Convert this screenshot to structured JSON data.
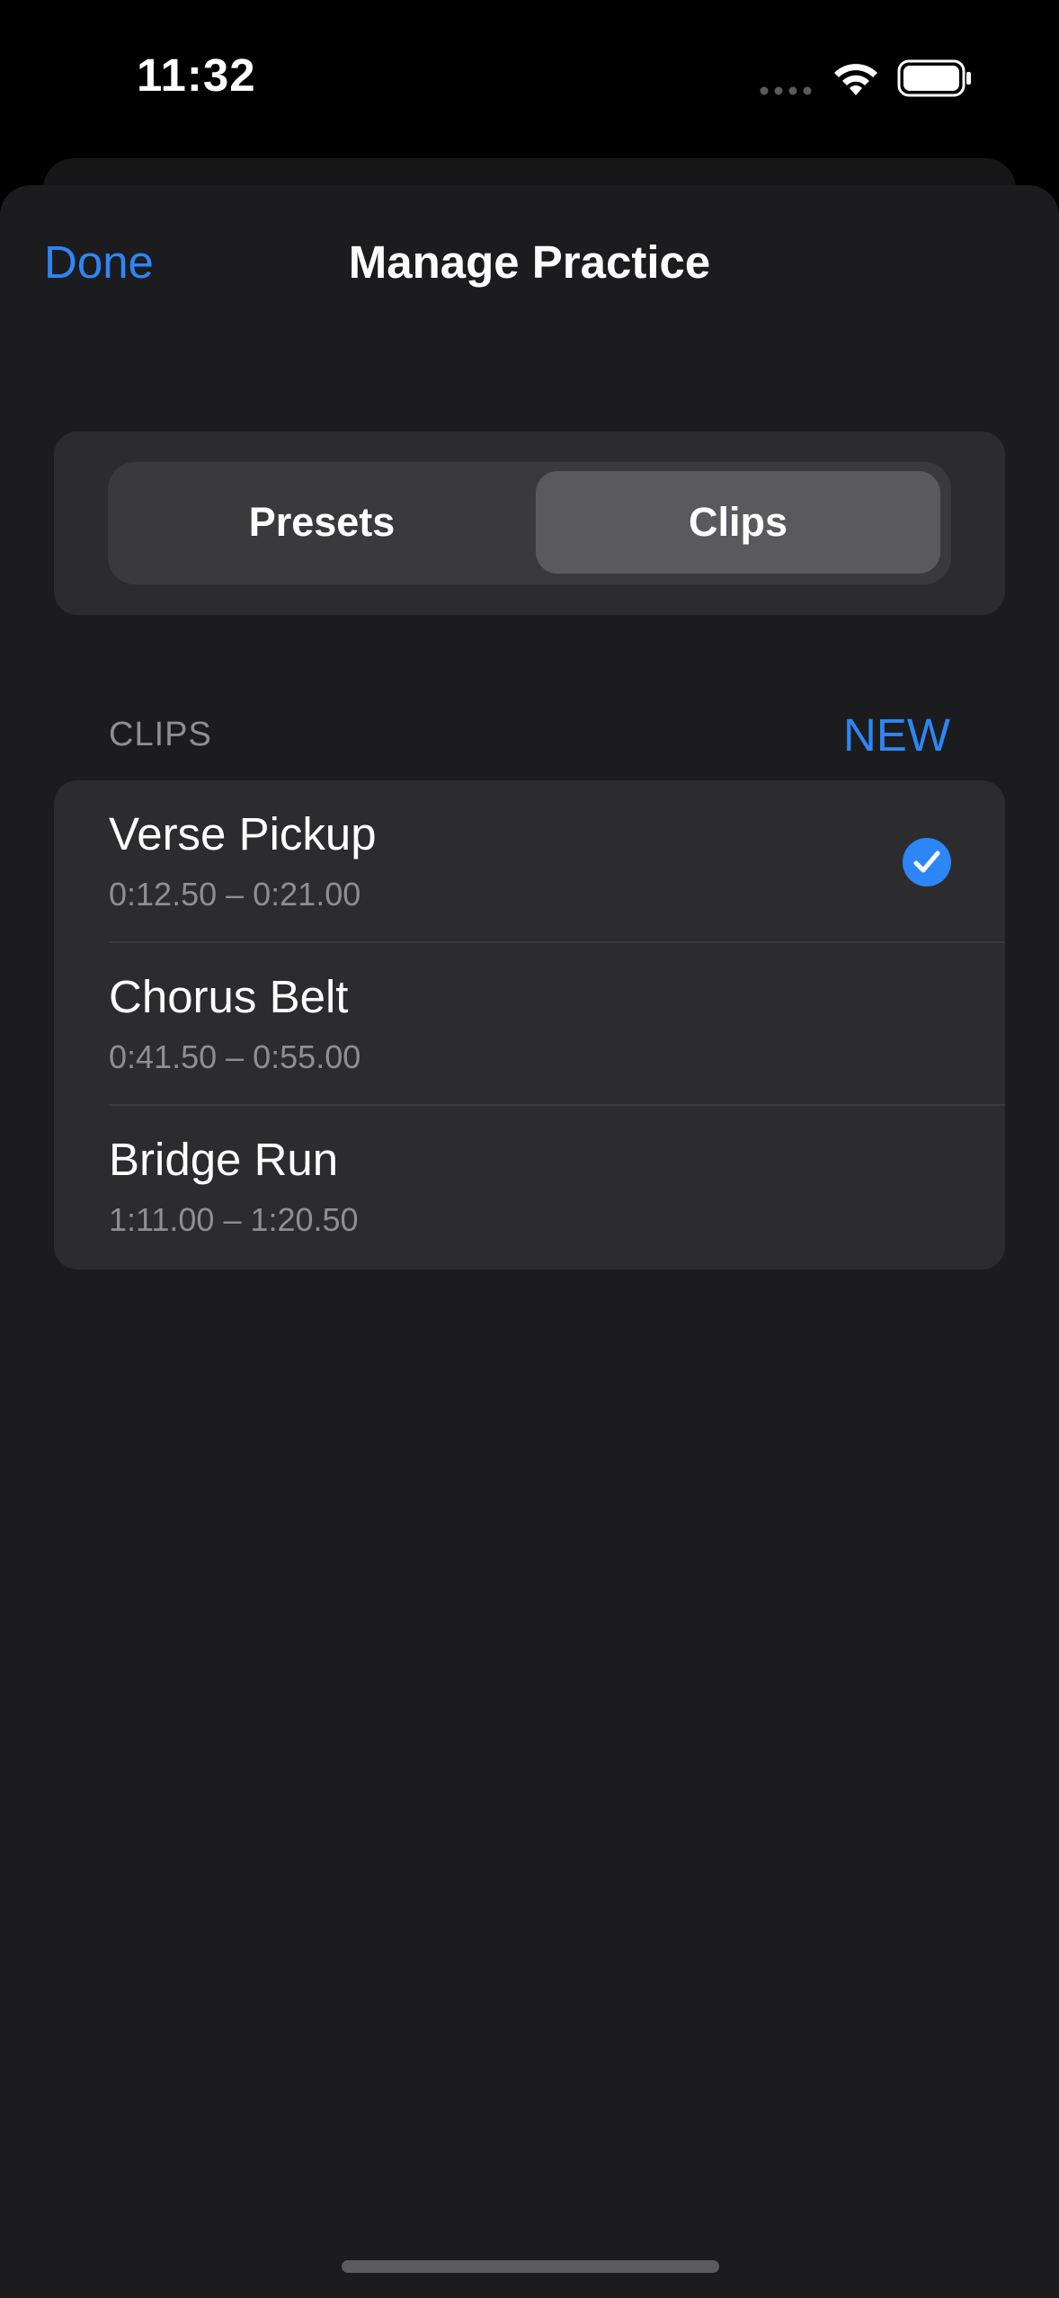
{
  "status_bar": {
    "time": "11:32"
  },
  "header": {
    "done_label": "Done",
    "title": "Manage Practice"
  },
  "segmented": {
    "options": [
      {
        "label": "Presets",
        "selected": false
      },
      {
        "label": "Clips",
        "selected": true
      }
    ]
  },
  "section": {
    "title": "CLIPS",
    "new_label": "NEW"
  },
  "clips": [
    {
      "name": "Verse Pickup",
      "range": "0:12.50 – 0:21.00",
      "selected": true
    },
    {
      "name": "Chorus Belt",
      "range": "0:41.50 – 0:55.00",
      "selected": false
    },
    {
      "name": "Bridge Run",
      "range": "1:11.00 – 1:20.50",
      "selected": false
    }
  ],
  "icons": {
    "status_signal": "signal-dots-icon",
    "status_wifi": "wifi-icon",
    "status_battery": "battery-icon",
    "selected_check": "checkmark-circle-icon"
  },
  "colors": {
    "accent": "#2d86f5",
    "sheet_bg": "#1c1c1e",
    "row_bg": "#2c2c2e",
    "secondary_text": "#8e8e93"
  }
}
